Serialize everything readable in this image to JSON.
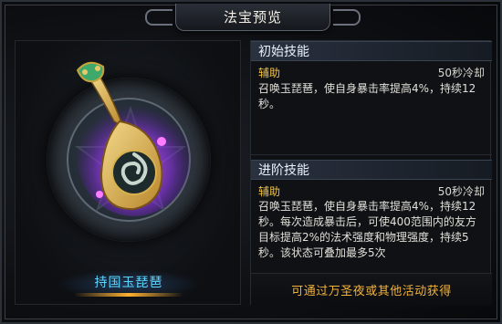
{
  "window": {
    "title": "法宝预览"
  },
  "item": {
    "name": "持国玉琵琶",
    "icon": "pipa-lute-icon",
    "colors": {
      "name": "#5fd6ff",
      "glow": "#b040ff",
      "wood": "#d8b04a"
    }
  },
  "skills": {
    "initial": {
      "heading": "初始技能",
      "type": "辅助",
      "cooldown": "50秒冷却",
      "description": "召唤玉琵琶，使自身暴击率提高4%，持续12秒。"
    },
    "advanced": {
      "heading": "进阶技能",
      "type": "辅助",
      "cooldown": "50秒冷却",
      "description": "召唤玉琵琶，使自身暴击率提高4%，持续12秒。每次造成暴击后，可使400范围内的友方目标提高2%的法术强度和物理强度，持续5秒。该状态可叠加最多5次"
    }
  },
  "obtain": {
    "text": "可通过万圣夜或其他活动获得"
  }
}
